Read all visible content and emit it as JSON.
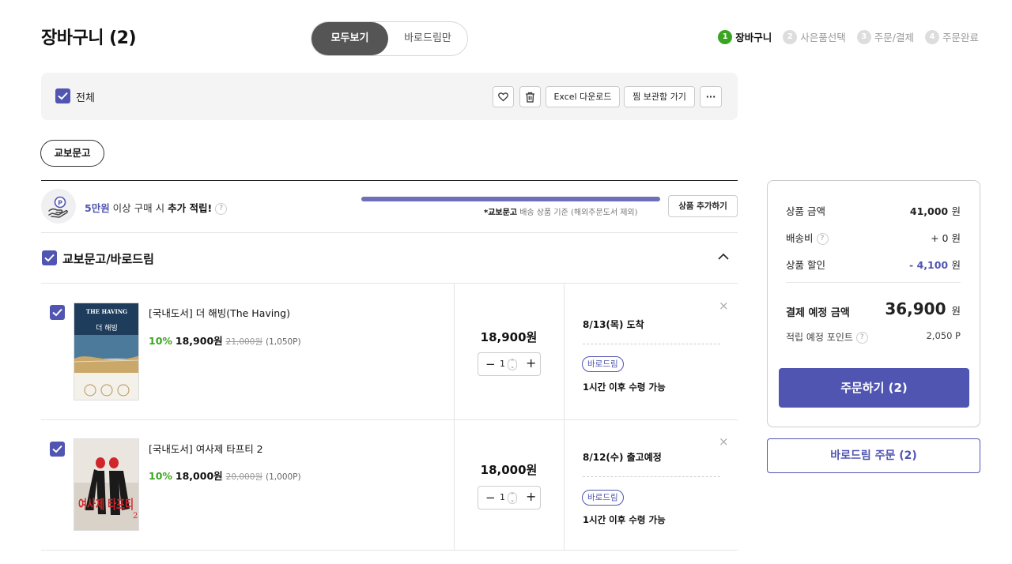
{
  "header": {
    "title": "장바구니 (2)",
    "view_all_label": "모두보기",
    "baro_only_label": "바로드림만"
  },
  "steps": [
    {
      "num": "1",
      "label": "장바구니",
      "active": true
    },
    {
      "num": "2",
      "label": "사은품선택",
      "active": false
    },
    {
      "num": "3",
      "label": "주문/결제",
      "active": false
    },
    {
      "num": "4",
      "label": "주문완료",
      "active": false
    }
  ],
  "toolbar": {
    "select_all_label": "전체",
    "excel_label": "Excel 다운로드",
    "wishlist_label": "찜 보관함 가기",
    "more_label": "···"
  },
  "store_chip": "교보문고",
  "promo": {
    "amount": "5만원",
    "text_mid": " 이상 구매 시 ",
    "text_bold": "추가 적립!",
    "help": "?",
    "progress": 1.0,
    "note_bold": "*교보문고",
    "note_rest": " 배송 상품 기준 (해외주문도서 제외)",
    "add_label": "상품 추가하기"
  },
  "section": {
    "title": "교보문고/바로드림"
  },
  "items": [
    {
      "title": "[국내도서] 더 해빙(The Having)",
      "discount": "10%",
      "sale_price": "18,900원",
      "orig_price": "21,000원",
      "points": "(1,050P)",
      "price": "18,900원",
      "qty": "1",
      "ship_date": "8/13(목) 도착",
      "tag": "바로드림",
      "pickup": "1시간 이후 수령 가능",
      "cover_title": "THE HAVING",
      "cover_sub": "더 해빙"
    },
    {
      "title": "[국내도서] 여사제 타프티 2",
      "discount": "10%",
      "sale_price": "18,000원",
      "orig_price": "20,000원",
      "points": "(1,000P)",
      "price": "18,000원",
      "qty": "1",
      "ship_date": "8/12(수) 출고예정",
      "tag": "바로드림",
      "pickup": "1시간 이후 수령 가능",
      "cover_title": "여사제 타프티",
      "cover_sub": "2"
    }
  ],
  "summary": {
    "goods_label": "상품 금액",
    "goods_value": "41,000",
    "shipping_label": "배송비",
    "shipping_value": "+ 0",
    "discount_label": "상품 할인",
    "discount_value": "- 4,100",
    "won": "원",
    "total_label": "결제 예정 금액",
    "total_value": "36,900",
    "points_label": "적립 예정 포인트",
    "points_value": "2,050 P",
    "order_label": "주문하기 (2)",
    "baro_order_label": "바로드림 주문 (2)"
  },
  "colors": {
    "accent": "#5055b1",
    "green": "#3aa520",
    "toggle_active": "#555555"
  }
}
